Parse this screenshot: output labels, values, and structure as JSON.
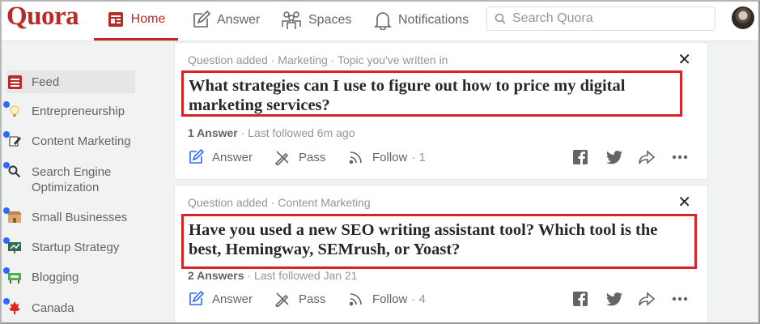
{
  "app": {
    "logo": "Quora"
  },
  "nav": {
    "home": "Home",
    "answer": "Answer",
    "spaces": "Spaces",
    "notifications": "Notifications",
    "search_placeholder": "Search Quora"
  },
  "sidebar": {
    "items": [
      {
        "label": "Feed",
        "icon": "feed-icon",
        "active": true
      },
      {
        "label": "Entrepreneurship",
        "icon": "lightbulb-icon"
      },
      {
        "label": "Content Marketing",
        "icon": "pencil-note-icon"
      },
      {
        "label": "Search Engine Optimization",
        "icon": "magnifier-icon"
      },
      {
        "label": "Small Businesses",
        "icon": "shop-icon"
      },
      {
        "label": "Startup Strategy",
        "icon": "chalkboard-icon"
      },
      {
        "label": "Blogging",
        "icon": "blog-sign-icon"
      },
      {
        "label": "Canada",
        "icon": "maple-leaf-icon"
      }
    ]
  },
  "feed": [
    {
      "meta": "Question added · Marketing · Topic you've written in",
      "question": "What strategies can I use to figure out how to price my digital marketing services?",
      "answers": "1 Answer",
      "followed": " · Last followed 6m ago",
      "actions": {
        "answer": "Answer",
        "pass": "Pass",
        "follow": "Follow",
        "follow_count": "· 1"
      }
    },
    {
      "meta": "Question added · Content Marketing",
      "question": "Have you used a new SEO writing assistant tool? Which tool is the best, Hemingway, SEMrush, or Yoast?",
      "answers": "2 Answers",
      "followed": " · Last followed Jan 21",
      "actions": {
        "answer": "Answer",
        "pass": "Pass",
        "follow": "Follow",
        "follow_count": "· 4"
      }
    }
  ],
  "colors": {
    "brand": "#b92b27",
    "highlight_box": "#d8232a",
    "dot": "#2e69ff"
  }
}
